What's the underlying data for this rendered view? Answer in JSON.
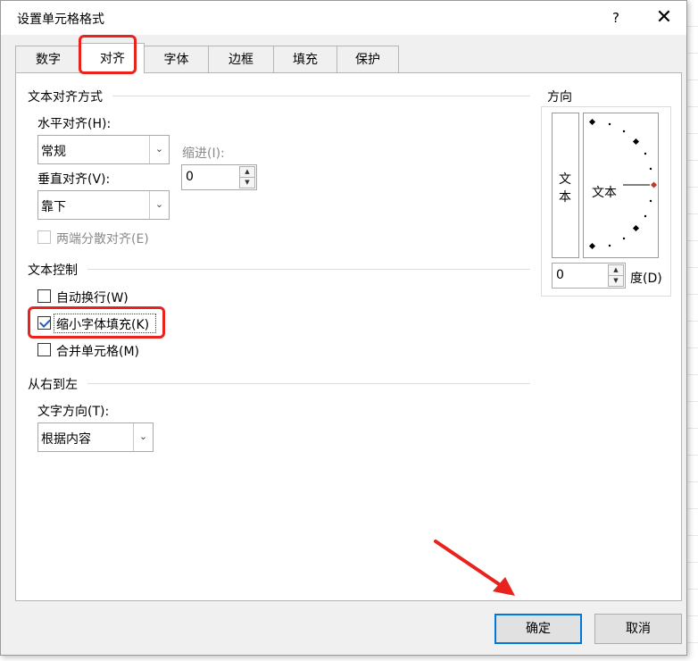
{
  "dialog": {
    "title": "设置单元格格式",
    "help": "?",
    "close": "✕"
  },
  "tabs": [
    {
      "label": "数字"
    },
    {
      "label": "对齐"
    },
    {
      "label": "字体"
    },
    {
      "label": "边框"
    },
    {
      "label": "填充"
    },
    {
      "label": "保护"
    }
  ],
  "text_alignment": {
    "title": "文本对齐方式",
    "horizontal_label": "水平对齐(H):",
    "horizontal_value": "常规",
    "vertical_label": "垂直对齐(V):",
    "vertical_value": "靠下",
    "indent_label": "缩进(I):",
    "indent_value": "0",
    "justify_distributed": "两端分散对齐(E)"
  },
  "text_control": {
    "title": "文本控制",
    "wrap_text": "自动换行(W)",
    "shrink_to_fit": "缩小字体填充(K)",
    "merge_cells": "合并单元格(M)"
  },
  "rtl": {
    "title": "从右到左",
    "direction_label": "文字方向(T):",
    "direction_value": "根据内容"
  },
  "orientation": {
    "title": "方向",
    "vertical_char1": "文",
    "vertical_char2": "本",
    "dial_text": "文本",
    "degrees_value": "0",
    "degrees_label": "度(D)"
  },
  "buttons": {
    "ok": "确定",
    "cancel": "取消"
  },
  "colors": {
    "annotation_red": "#e8231e",
    "accent_blue": "#0078d7"
  }
}
